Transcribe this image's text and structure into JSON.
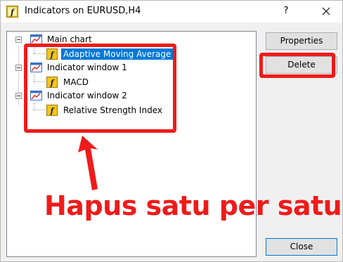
{
  "window": {
    "title": "Indicators on EURUSD,H4",
    "help_label": "?",
    "close_label": "✕"
  },
  "tree": {
    "groups": [
      {
        "label": "Main chart",
        "items": [
          {
            "label": "Adaptive Moving Average",
            "selected": true
          }
        ]
      },
      {
        "label": "Indicator window 1",
        "items": [
          {
            "label": "MACD",
            "selected": false
          }
        ]
      },
      {
        "label": "Indicator window 2",
        "items": [
          {
            "label": "Relative Strength Index",
            "selected": false
          }
        ]
      }
    ]
  },
  "buttons": {
    "properties": "Properties",
    "delete": "Delete",
    "close": "Close"
  },
  "annotation": {
    "text": "Hapus satu per satu",
    "color": "#ef1b1b"
  },
  "colors": {
    "selection": "#0078d7",
    "highlight": "#ef1b1b",
    "icon_yellow": "#f5c518"
  },
  "icons": {
    "chart": "chart-window-icon",
    "indicator": "function-f-icon"
  }
}
